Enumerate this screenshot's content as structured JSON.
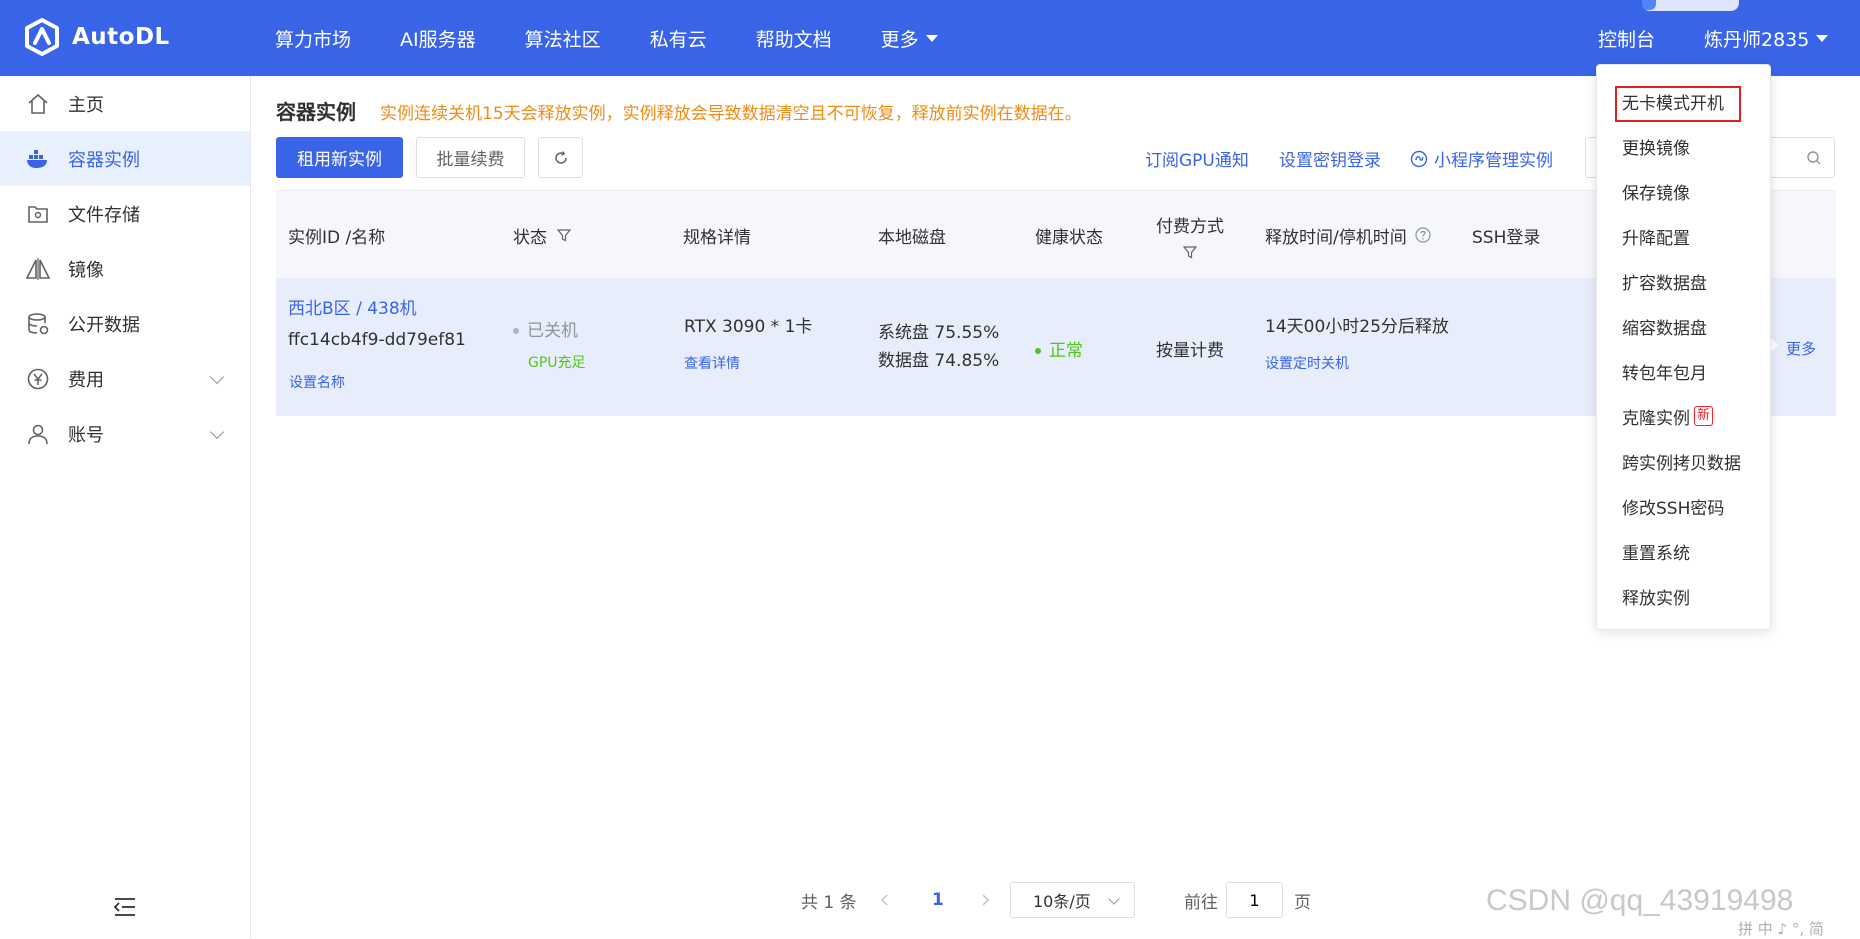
{
  "brand": {
    "name": "AutoDL",
    "accent": "#3a64e8"
  },
  "nav": {
    "items": [
      "算力市场",
      "AI服务器",
      "算法社区",
      "私有云",
      "帮助文档"
    ],
    "more_label": "更多",
    "console_label": "控制台",
    "user_label": "炼丹师2835"
  },
  "sidebar": {
    "items": [
      {
        "label": "主页",
        "icon": "home-icon"
      },
      {
        "label": "容器实例",
        "icon": "container-icon"
      },
      {
        "label": "文件存储",
        "icon": "storage-icon"
      },
      {
        "label": "镜像",
        "icon": "image-icon"
      },
      {
        "label": "公开数据",
        "icon": "database-icon"
      },
      {
        "label": "费用",
        "icon": "yen-icon"
      },
      {
        "label": "账号",
        "icon": "user-icon"
      }
    ]
  },
  "page": {
    "title": "容器实例",
    "notice": "实例连续关机15天会释放实例，实例释放会导致数据清空且不可恢复，释放前实例在数据在。",
    "rent_button": "租用新实例",
    "renew_button": "批量续费",
    "link_gpu_notify": "订阅GPU通知",
    "link_ssh_key": "设置密钥登录",
    "link_miniprogram": "小程序管理实例",
    "search_placeholder": ""
  },
  "table": {
    "headers": {
      "id": "实例ID /名称",
      "status": "状态",
      "spec": "规格详情",
      "disk": "本地磁盘",
      "health": "健康状态",
      "pay_line1": "付费方式",
      "release": "释放时间/停机时间",
      "ssh": "SSH登录"
    },
    "row": {
      "region": "西北B区 / 438机",
      "instance_id": "ffc14cb4f9-dd79ef81",
      "set_name": "设置名称",
      "status": "已关机",
      "gpu_status": "GPU充足",
      "spec": "RTX 3090 * 1卡",
      "spec_detail": "查看详情",
      "sys_disk": "系统盘 75.55%",
      "data_disk": "数据盘 74.85%",
      "health": "正常",
      "pay": "按量计费",
      "release": "14天00小时25分后释放",
      "set_shutdown": "设置定时关机",
      "more": "更多"
    }
  },
  "pagination": {
    "total": "共 1 条",
    "current": "1",
    "page_size": "10条/页",
    "goto_label": "前往",
    "goto_value": "1",
    "page_suffix": "页"
  },
  "dropdown": {
    "items": [
      "无卡模式开机",
      "更换镜像",
      "保存镜像",
      "升降配置",
      "扩容数据盘",
      "缩容数据盘",
      "转包年包月",
      "克隆实例",
      "跨实例拷贝数据",
      "修改SSH密码",
      "重置系统",
      "释放实例"
    ],
    "new_badge": "新"
  },
  "watermark": "CSDN @qq_43919498",
  "ime": "拼 中 ♪ °, 简"
}
